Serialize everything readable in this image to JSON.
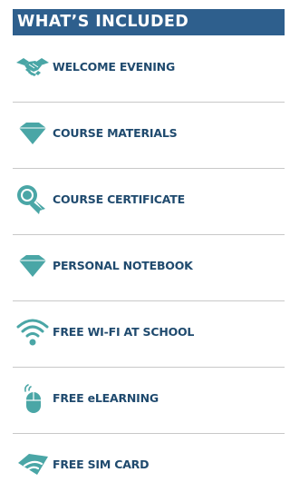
{
  "header": {
    "title": "WHAT’S INCLUDED"
  },
  "accent_color": "#4aa6a6",
  "header_color": "#2e5f8d",
  "items": [
    {
      "label": "WELCOME EVENING",
      "icon": "handshake-icon"
    },
    {
      "label": "COURSE MATERIALS",
      "icon": "diamond-icon"
    },
    {
      "label": "COURSE CERTIFICATE",
      "icon": "award-ribbon-icon"
    },
    {
      "label": "PERSONAL NOTEBOOK",
      "icon": "diamond-icon"
    },
    {
      "label": "FREE WI-FI AT SCHOOL",
      "icon": "wifi-icon"
    },
    {
      "label": "FREE eLEARNING",
      "icon": "mouse-icon"
    },
    {
      "label": "FREE SIM CARD",
      "icon": "sim-card-icon"
    }
  ]
}
